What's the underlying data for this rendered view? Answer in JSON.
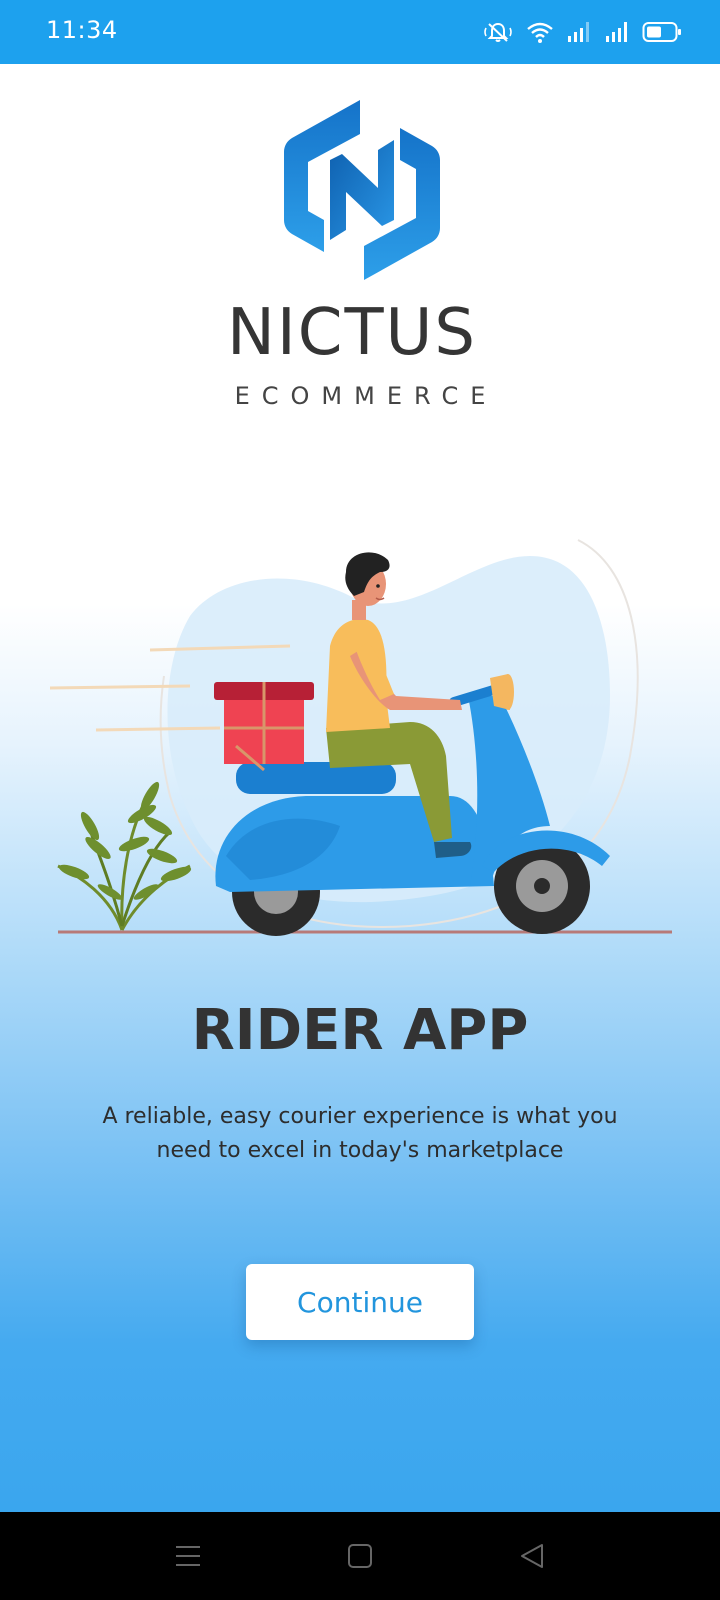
{
  "status_bar": {
    "time": "11:34",
    "icons": [
      "mute-icon",
      "wifi-icon",
      "signal-icon",
      "signal-icon",
      "battery-icon"
    ]
  },
  "brand": {
    "name": "NICTUS",
    "subtitle": "ECOMMERCE"
  },
  "illustration": {
    "description": "delivery-rider-on-scooter"
  },
  "content": {
    "headline": "RIDER APP",
    "tagline": "A reliable, easy courier experience is what you need to excel in today's marketplace"
  },
  "actions": {
    "continue_label": "Continue"
  },
  "nav_bar": {
    "buttons": [
      "menu-icon",
      "home-icon",
      "back-icon"
    ]
  },
  "colors": {
    "status_bar": "#1da1ee",
    "accent": "#2295dd",
    "logo_blue": "#1e7fd3",
    "gradient_bottom": "#3aa6ee"
  }
}
